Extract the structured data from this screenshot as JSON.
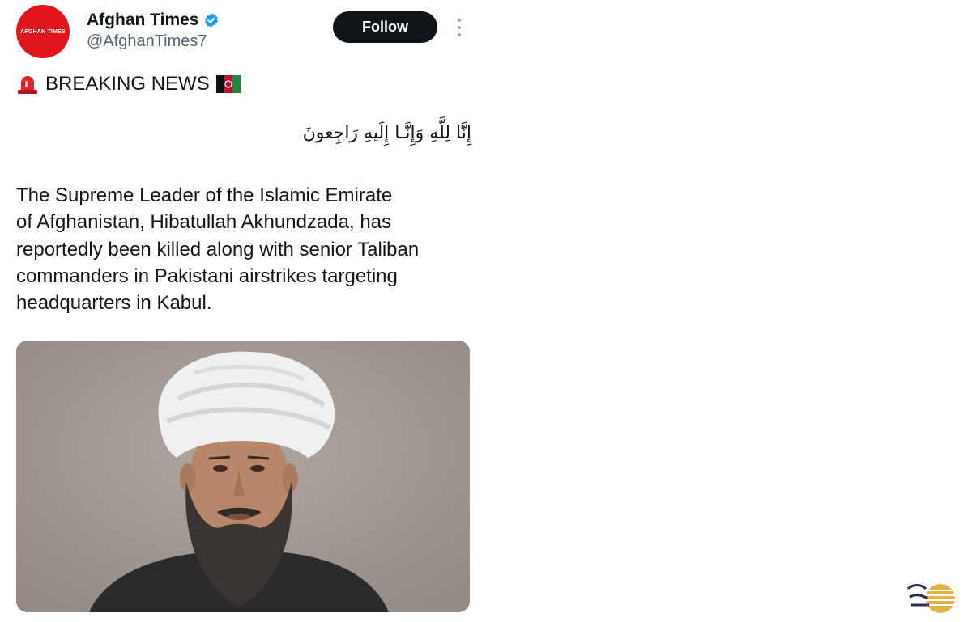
{
  "account": {
    "avatar_text": "AFGHAN TIMES",
    "display_name": "Afghan Times",
    "handle": "@AfghanTimes7",
    "verified": true,
    "verified_icon": "verified-badge-icon",
    "brand_color": "#e0161c"
  },
  "actions": {
    "follow_label": "Follow",
    "more_icon": "more-vertical-icon"
  },
  "tweet": {
    "headline": "BREAKING NEWS",
    "headline_icons": [
      "siren-icon",
      "afghanistan-flag-icon"
    ],
    "arabic_line": "إِنَّا لِلَّهِ وَإِنَّـا إِلَيهِ رَاجِعونَ",
    "body_lines": [
      "The Supreme Leader of the Islamic Emirate",
      "of Afghanistan, Hibatullah Akhundzada, has",
      "reportedly been killed along with senior Taliban",
      "commanders in Pakistani airstrikes targeting",
      "headquarters in Kabul."
    ],
    "media": "portrait-photo"
  },
  "colors": {
    "text": "#0f1419",
    "secondary": "#536471",
    "button": "#0f1419",
    "verified": "#1d9bf0"
  }
}
